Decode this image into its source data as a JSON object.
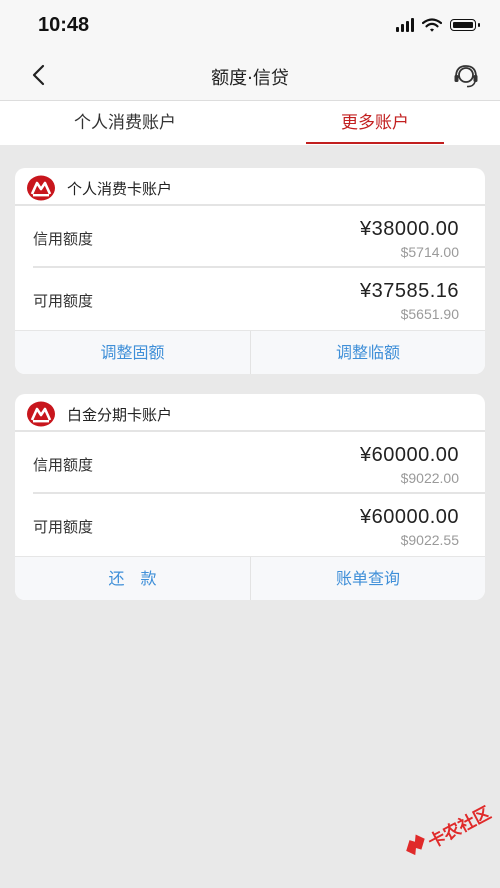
{
  "status": {
    "time": "10:48"
  },
  "nav": {
    "title": "额度·信贷"
  },
  "tabs": [
    {
      "label": "个人消费账户",
      "active": false
    },
    {
      "label": "更多账户",
      "active": true
    }
  ],
  "cards": [
    {
      "title": "个人消费卡账户",
      "rows": [
        {
          "label": "信用额度",
          "amount": "¥38000.00",
          "usd": "$5714.00"
        },
        {
          "label": "可用额度",
          "amount": "¥37585.16",
          "usd": "$5651.90"
        }
      ],
      "actions": [
        "调整固额",
        "调整临额"
      ]
    },
    {
      "title": "白金分期卡账户",
      "rows": [
        {
          "label": "信用额度",
          "amount": "¥60000.00",
          "usd": "$9022.00"
        },
        {
          "label": "可用额度",
          "amount": "¥60000.00",
          "usd": "$9022.55"
        }
      ],
      "actions": [
        "还　款",
        "账单查询"
      ]
    }
  ],
  "watermark": {
    "text": "卡农社区"
  },
  "colors": {
    "accent": "#c21f1f",
    "link": "#3f8fd8",
    "background": "#e9e9e9"
  },
  "icons": [
    "back-chevron-icon",
    "customer-service-icon",
    "bank-logo-icon",
    "signal-icon",
    "wifi-icon",
    "battery-icon"
  ]
}
